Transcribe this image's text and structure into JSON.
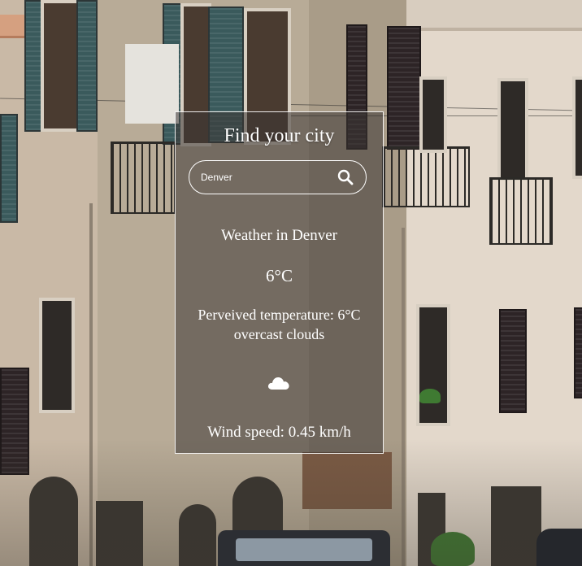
{
  "card": {
    "title": "Find your city",
    "search": {
      "value": "Denver",
      "placeholder": "",
      "button_icon": "search-icon"
    },
    "weather_title": "Weather in Denver",
    "temperature": "6°C",
    "perceived": "Perveived temperature: 6°C",
    "description": "overcast clouds",
    "condition_icon": "cloud-icon",
    "wind": "Wind speed: 0.45 km/h"
  },
  "colors": {
    "card_background": "#3c3634",
    "text": "#ffffff",
    "border": "#ffffff"
  }
}
